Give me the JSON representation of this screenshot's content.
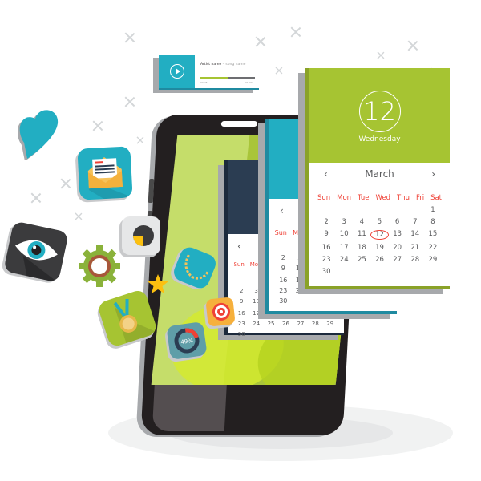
{
  "scene": {
    "description": "Smartphone with floating app icons and calendar cards",
    "colors": {
      "lime": "#a6c432",
      "teal": "#22aec2",
      "navy": "#2b3d52",
      "phone": "#231f20",
      "accent_red": "#ef4136",
      "shadow_gray": "#a7a9ac"
    }
  },
  "music_card": {
    "icon": "play-icon",
    "artist": "Artist name",
    "separator": " – ",
    "song": "song name",
    "progress": 0.5,
    "time_elapsed": "00:45",
    "time_total": "01:30"
  },
  "calendar": {
    "date": "12",
    "weekday": "Wednesday",
    "month": "March",
    "prev_label": "‹",
    "next_label": "›",
    "weekdays": [
      "Sun",
      "Mon",
      "Tue",
      "Wed",
      "Thu",
      "Fri",
      "Sat"
    ],
    "selected_day": 12,
    "weeks": [
      [
        "",
        "",
        "",
        "",
        "",
        "",
        "1"
      ],
      [
        "2",
        "3",
        "4",
        "5",
        "6",
        "7",
        "8"
      ],
      [
        "9",
        "10",
        "11",
        "12",
        "13",
        "14",
        "15"
      ],
      [
        "16",
        "17",
        "18",
        "19",
        "20",
        "21",
        "22"
      ],
      [
        "23",
        "24",
        "25",
        "26",
        "27",
        "28",
        "29"
      ],
      [
        "30",
        "",
        "",
        "",
        "",
        "",
        ""
      ]
    ]
  },
  "floating_icons": [
    {
      "name": "heart-icon",
      "color": "#22aec2"
    },
    {
      "name": "mail-icon",
      "color": "#22aec2"
    },
    {
      "name": "eye-icon",
      "color": "#3b3b3d"
    },
    {
      "name": "gear-icon",
      "color": "#8ab23a"
    },
    {
      "name": "pie-chart-icon",
      "color": "#e6e7e8"
    },
    {
      "name": "star-icon",
      "color": "#fcc010"
    },
    {
      "name": "medal-icon",
      "color": "#a6c432"
    },
    {
      "name": "laurel-icon",
      "color": "#22aec2"
    },
    {
      "name": "target-icon",
      "color": "#f6b03c"
    },
    {
      "name": "donut-progress-icon",
      "color": "#5f9ea8"
    }
  ],
  "donut_progress": {
    "value_label": "49%",
    "value": 0.49
  }
}
